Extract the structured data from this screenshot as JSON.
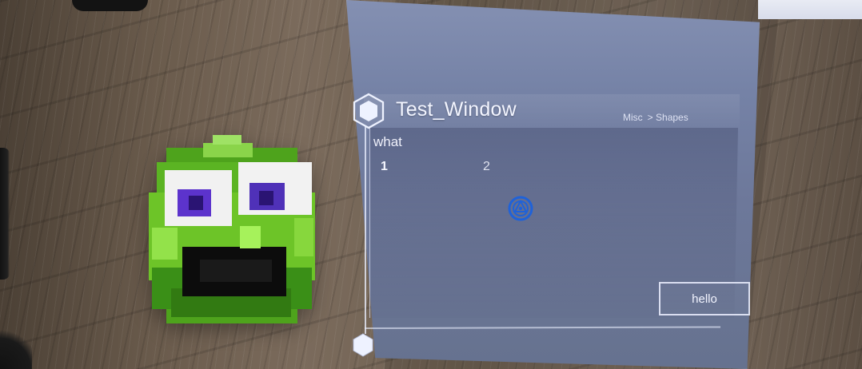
{
  "window": {
    "title": "Test_Window",
    "breadcrumb": [
      "Misc",
      "> Shapes"
    ]
  },
  "content": {
    "label": "what",
    "tabs": [
      {
        "label": "1"
      },
      {
        "label": "2"
      }
    ],
    "button": {
      "label": "hello"
    }
  },
  "icons": {
    "title_icon": "hexagon-icon",
    "resize_handle": "hexagon-icon",
    "shape_icon": "circle-target-icon"
  },
  "colors": {
    "panel": "#7582a6",
    "content": "#5f6b90",
    "text": "#f3f5ff",
    "shape_icon": "#1f62d9"
  }
}
